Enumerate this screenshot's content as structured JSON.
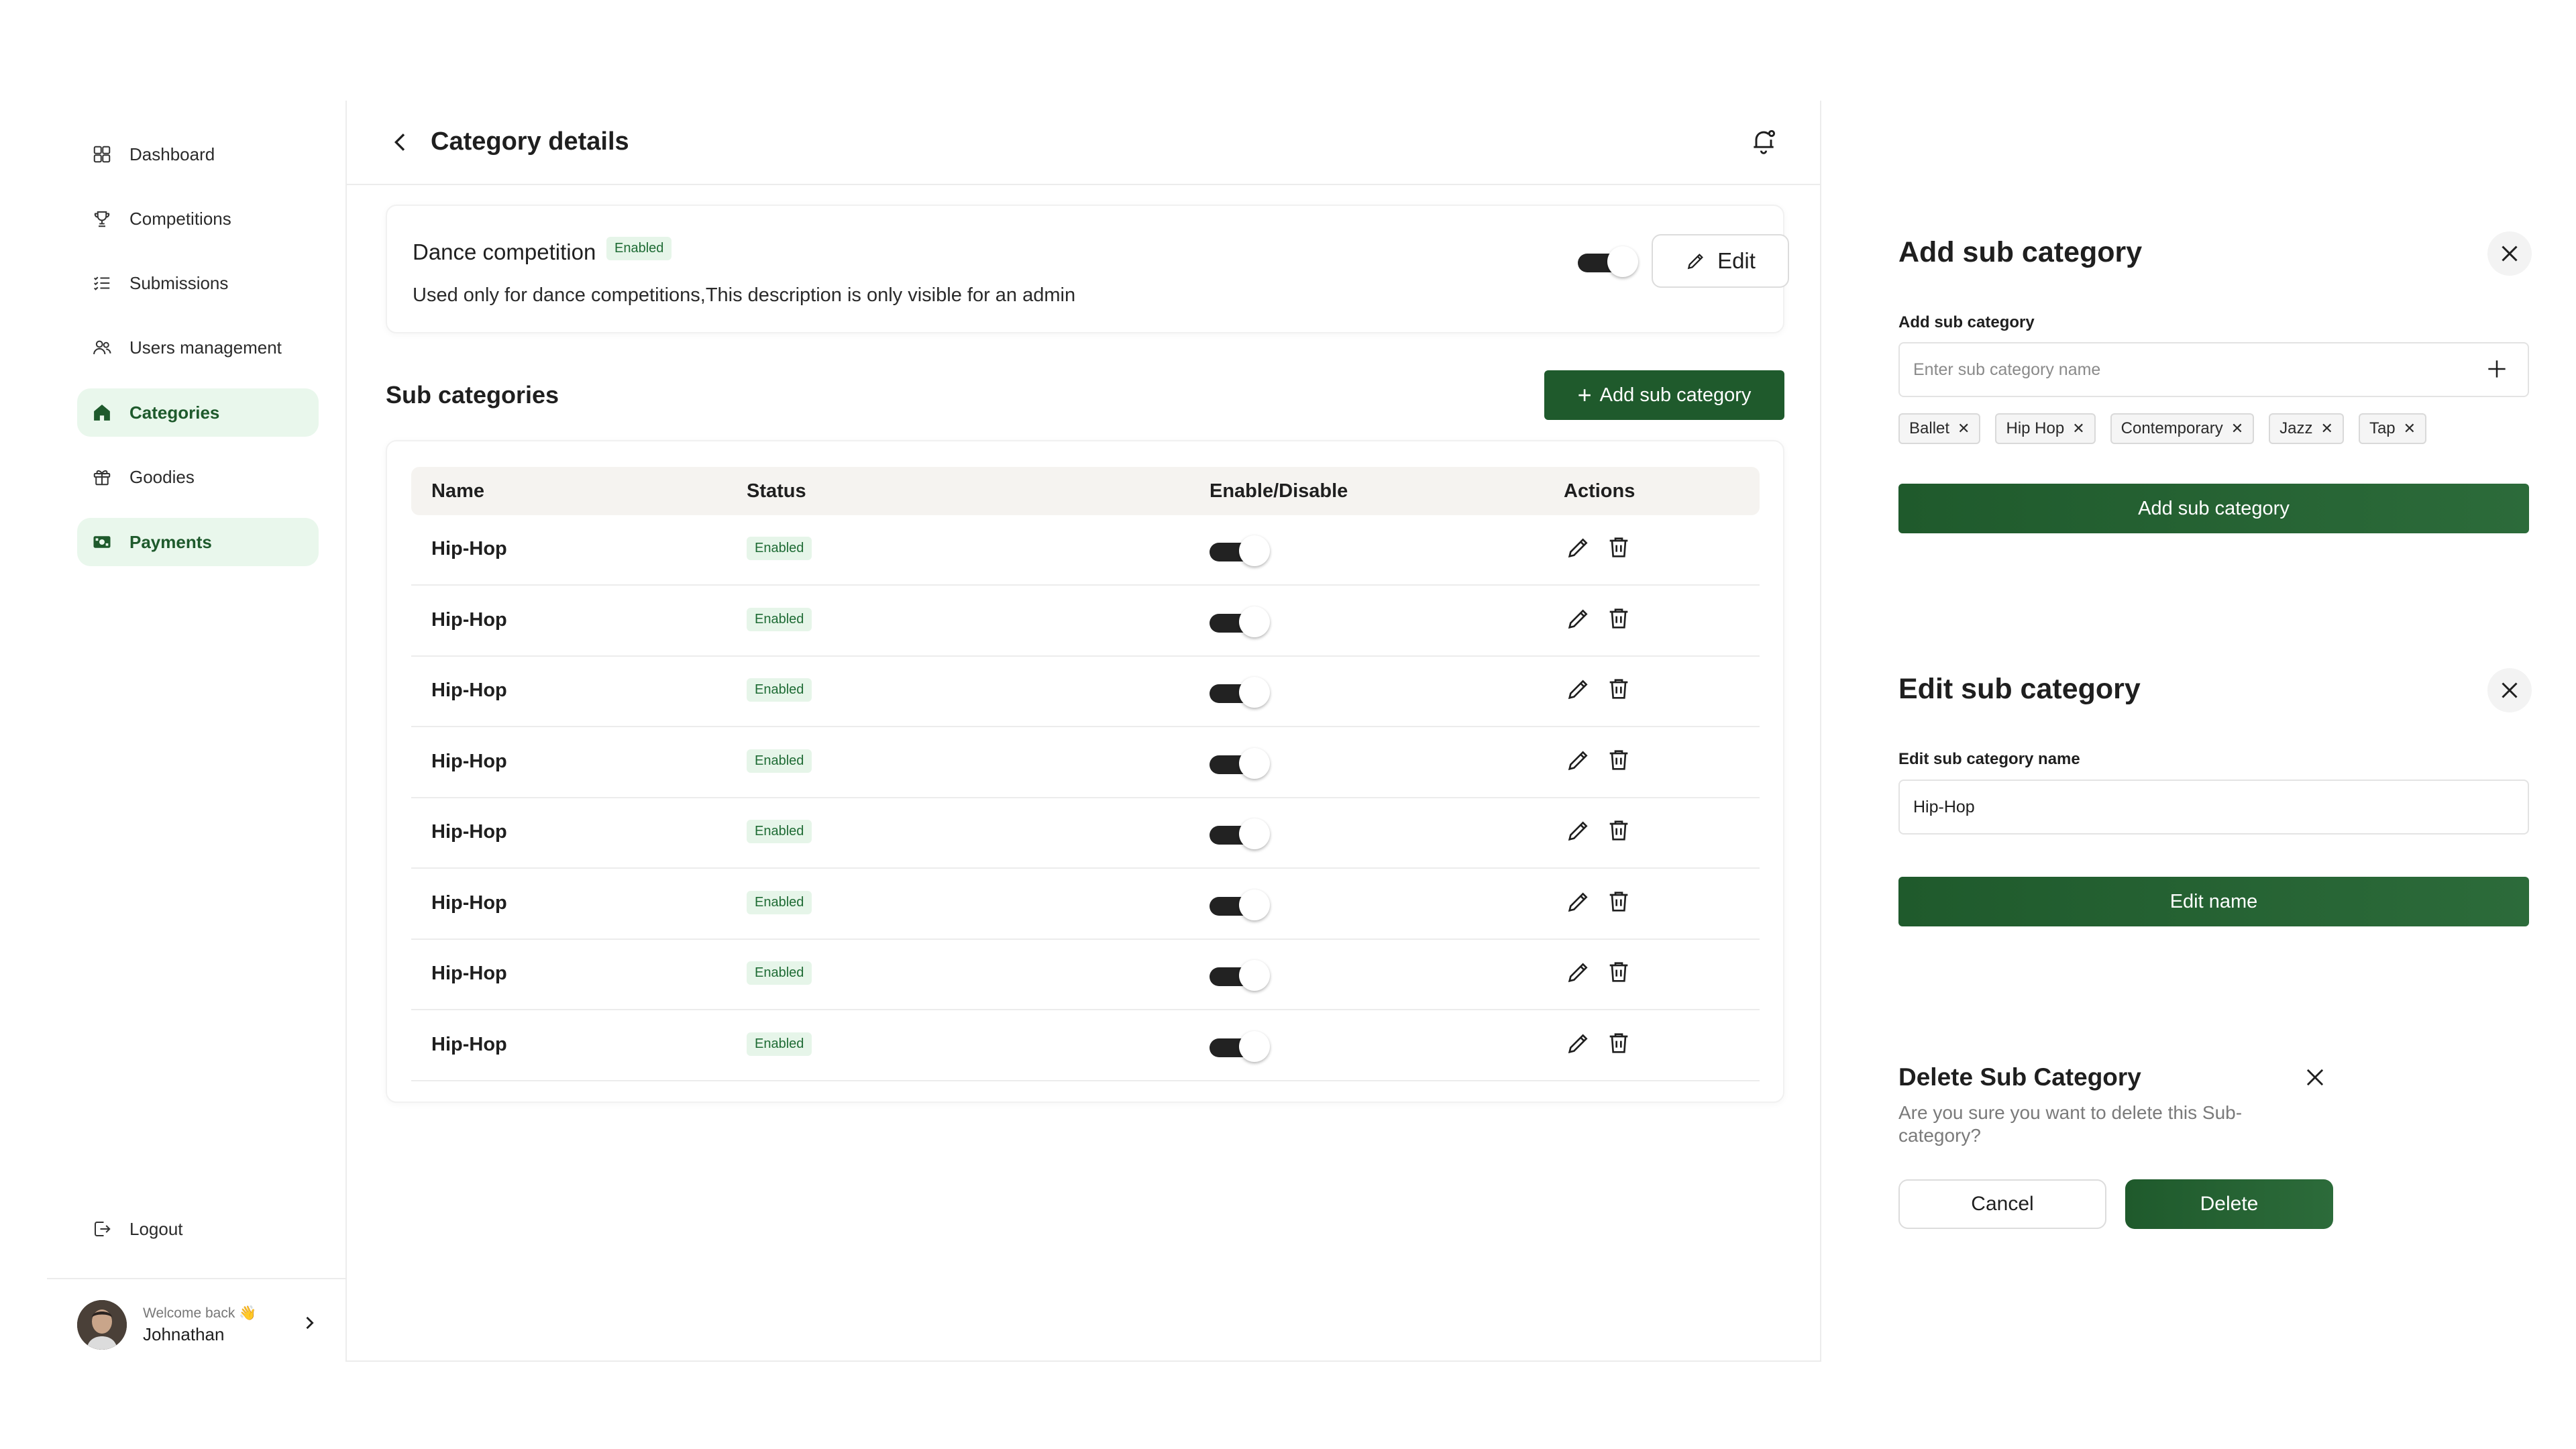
{
  "sidebar": {
    "items": [
      {
        "label": "Dashboard",
        "icon": "dashboard-icon",
        "active": false
      },
      {
        "label": "Competitions",
        "icon": "trophy-icon",
        "active": false
      },
      {
        "label": "Submissions",
        "icon": "list-icon",
        "active": false
      },
      {
        "label": "Users management",
        "icon": "users-icon",
        "active": false
      },
      {
        "label": "Categories",
        "icon": "home-icon",
        "active": true
      },
      {
        "label": "Goodies",
        "icon": "gift-icon",
        "active": false
      },
      {
        "label": "Payments",
        "icon": "money-icon",
        "active": true
      }
    ],
    "logout_label": "Logout",
    "user": {
      "welcome": "Welcome back 👋",
      "name": "Johnathan"
    }
  },
  "header": {
    "title": "Category details"
  },
  "category": {
    "name": "Dance competition",
    "status": "Enabled",
    "description": "Used only for dance competitions,This description is only visible for an admin",
    "enabled": true,
    "edit_label": "Edit"
  },
  "sub_categories": {
    "title": "Sub categories",
    "add_button_label": "Add sub category",
    "columns": [
      "Name",
      "Status",
      "Enable/Disable",
      "Actions"
    ],
    "rows": [
      {
        "name": "Hip-Hop",
        "status": "Enabled",
        "enabled": true
      },
      {
        "name": "Hip-Hop",
        "status": "Enabled",
        "enabled": true
      },
      {
        "name": "Hip-Hop",
        "status": "Enabled",
        "enabled": true
      },
      {
        "name": "Hip-Hop",
        "status": "Enabled",
        "enabled": true
      },
      {
        "name": "Hip-Hop",
        "status": "Enabled",
        "enabled": true
      },
      {
        "name": "Hip-Hop",
        "status": "Enabled",
        "enabled": true
      },
      {
        "name": "Hip-Hop",
        "status": "Enabled",
        "enabled": true
      },
      {
        "name": "Hip-Hop",
        "status": "Enabled",
        "enabled": true
      }
    ]
  },
  "add_modal": {
    "title": "Add sub category",
    "field_label": "Add sub category",
    "placeholder": "Enter sub category name",
    "chips": [
      "Ballet",
      "Hip Hop",
      "Contemporary",
      "Jazz",
      "Tap"
    ],
    "button_label": "Add sub category"
  },
  "edit_modal": {
    "title": "Edit sub category",
    "field_label": "Edit sub category name",
    "value": "Hip-Hop",
    "button_label": "Edit name"
  },
  "delete_modal": {
    "title": "Delete Sub Category",
    "message": "Are you sure you want to delete this Sub-category?",
    "cancel_label": "Cancel",
    "delete_label": "Delete"
  },
  "colors": {
    "primary": "#1f5a2c",
    "active_nav_bg": "#e9f7ec",
    "badge_bg": "#e6f5e9",
    "badge_text": "#1e6b34"
  }
}
